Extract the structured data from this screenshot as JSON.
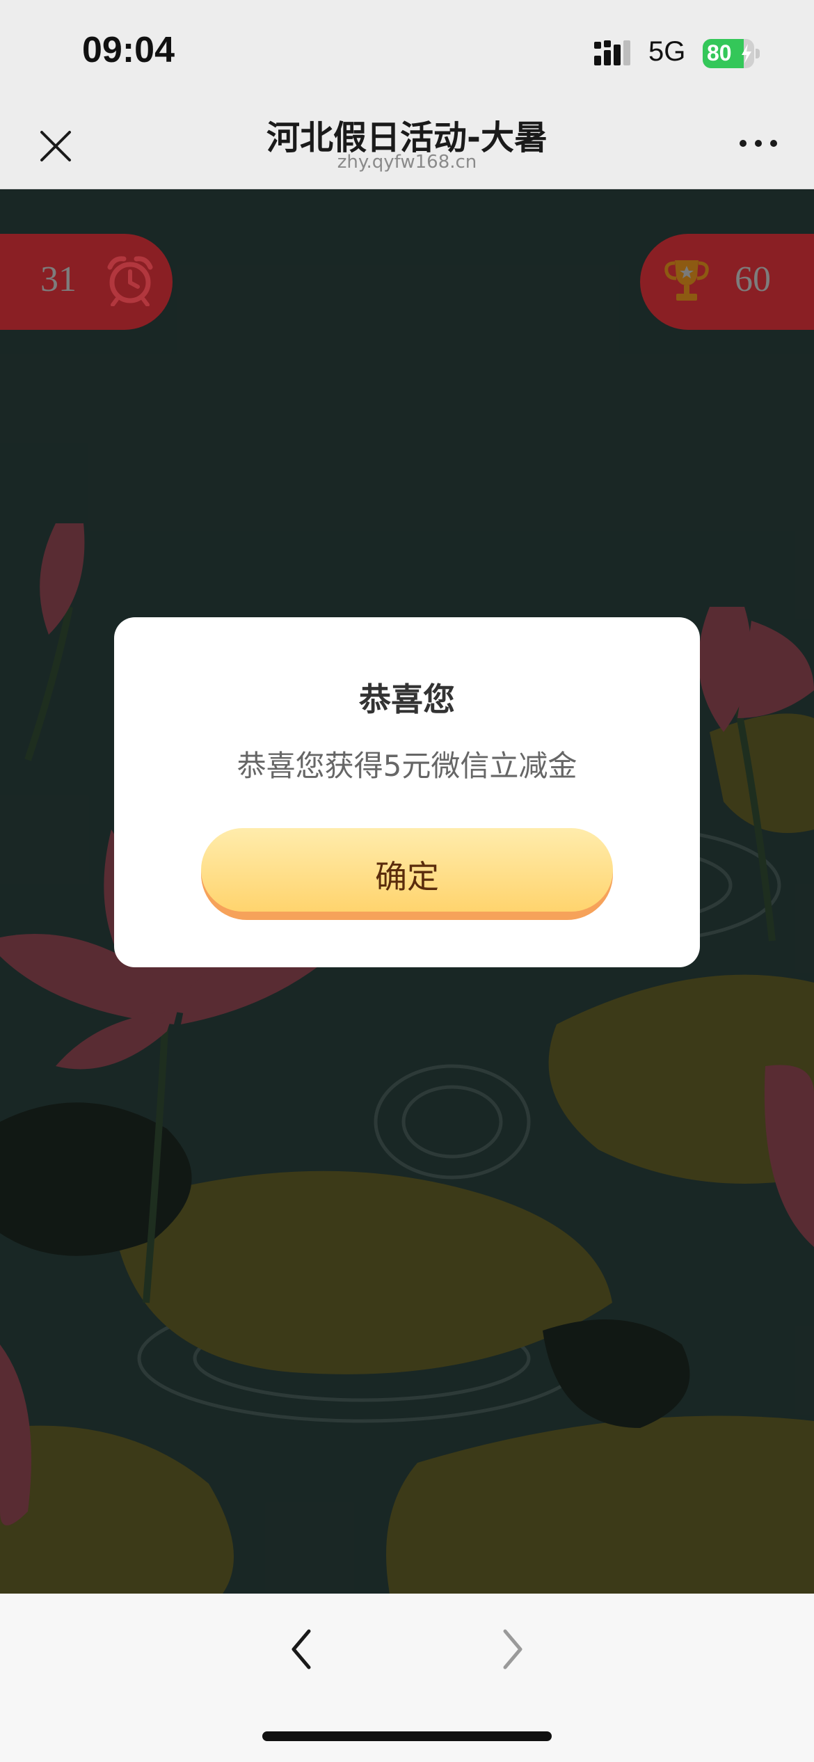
{
  "status_bar": {
    "time": "09:04",
    "network": "5G",
    "battery_percent": "80",
    "battery_level": 0.8,
    "icons": [
      "signal-icon",
      "battery-icon",
      "charging-bolt-icon"
    ]
  },
  "nav": {
    "title": "河北假日活动-大暑",
    "url": "zhy.qyfw168.cn",
    "icons": [
      "close-icon",
      "more-icon"
    ]
  },
  "game": {
    "timer_value": "31",
    "score_value": "60",
    "icons": [
      "alarm-clock-icon",
      "trophy-icon"
    ],
    "pill_color": "#8a1f24"
  },
  "dialog": {
    "title": "恭喜您",
    "message": "恭喜您获得5元微信立减金",
    "confirm_label": "确定",
    "button_gradient": [
      "#ffecac",
      "#ffd46e"
    ],
    "button_shadow_color": "#f6a25a"
  },
  "toolbar": {
    "icons": [
      "back-chevron-icon",
      "forward-chevron-icon"
    ]
  }
}
